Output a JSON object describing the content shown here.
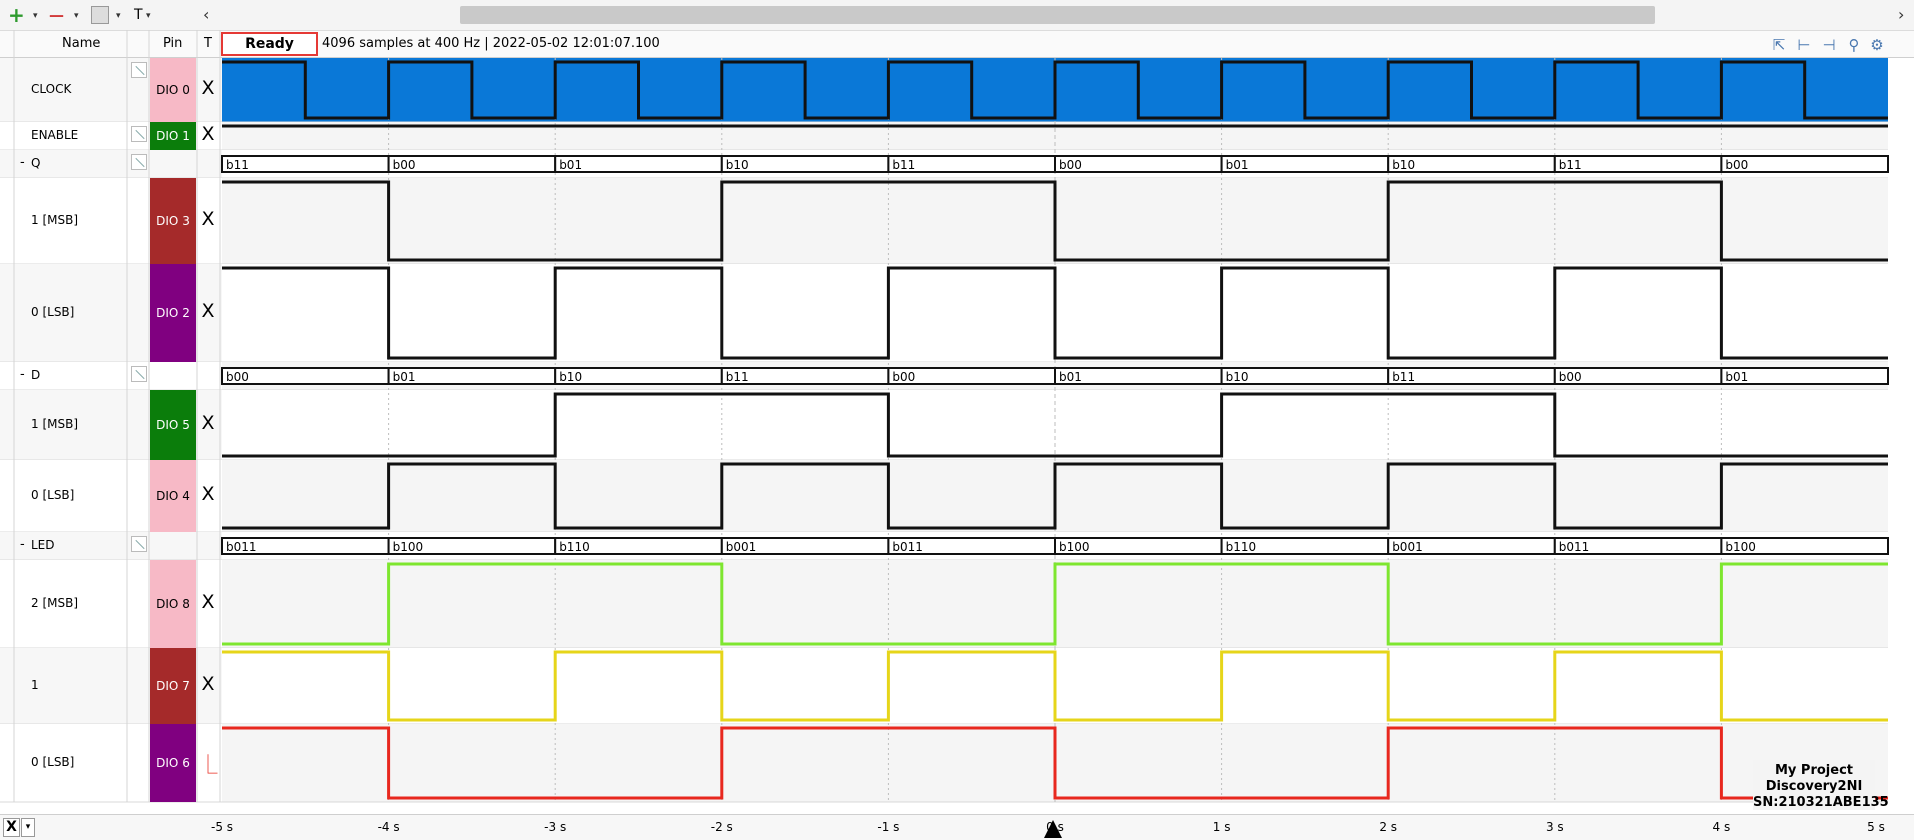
{
  "toolbar": {
    "add_icon": "+",
    "remove_icon": "—",
    "edit_icon": "edit",
    "text_icon": "T",
    "caret": "▾",
    "scroll_left": "‹",
    "scroll_right": "›"
  },
  "header": {
    "col_name": "Name",
    "col_pin": "Pin",
    "col_trigger": "T",
    "status": "Ready",
    "acquisition": "4096 samples at 400 Hz | 2022-05-02 12:01:07.100"
  },
  "colors": {
    "clock_fill": "#0a78d7",
    "row_alt": "#f5f5f5",
    "led_msb": "#7ee62f",
    "led_mid": "#e6d51a",
    "led_lsb": "#e8281e"
  },
  "channels": [
    {
      "name": "CLOCK",
      "pin": "DIO  0",
      "trigger": "X",
      "pin_color": "#f7b9c6",
      "pin_text": "#000"
    },
    {
      "name": "ENABLE",
      "pin": "DIO  1",
      "trigger": "X",
      "pin_color": "#0b7d0b",
      "pin_text": "#fff"
    },
    {
      "name": "Q",
      "toggle": "-",
      "pin": "",
      "trigger": ""
    },
    {
      "name": "1 [MSB]",
      "pin": "DIO  3",
      "trigger": "X",
      "pin_color": "#a52a2a",
      "pin_text": "#fff"
    },
    {
      "name": "0 [LSB]",
      "pin": "DIO  2",
      "trigger": "X",
      "pin_color": "#800080",
      "pin_text": "#fff"
    },
    {
      "name": "D",
      "toggle": "-",
      "pin": "",
      "trigger": ""
    },
    {
      "name": "1 [MSB]",
      "pin": "DIO  5",
      "trigger": "X",
      "pin_color": "#0b7d0b",
      "pin_text": "#fff"
    },
    {
      "name": "0 [LSB]",
      "pin": "DIO  4",
      "trigger": "X",
      "pin_color": "#f7b9c6",
      "pin_text": "#000"
    },
    {
      "name": "LED",
      "toggle": "-",
      "pin": "",
      "trigger": ""
    },
    {
      "name": "2 [MSB]",
      "pin": "DIO  8",
      "trigger": "X",
      "pin_color": "#f7b9c6",
      "pin_text": "#000"
    },
    {
      "name": "1",
      "pin": "DIO  7",
      "trigger": "X",
      "pin_color": "#a52a2a",
      "pin_text": "#fff"
    },
    {
      "name": "0 [LSB]",
      "pin": "DIO  6",
      "trigger": "⎿",
      "pin_color": "#800080",
      "pin_text": "#fff"
    }
  ],
  "bus_values": {
    "Q": [
      "b11",
      "b00",
      "b01",
      "b10",
      "b11",
      "b00",
      "b01",
      "b10",
      "b11",
      "b00"
    ],
    "D": [
      "b00",
      "b01",
      "b10",
      "b11",
      "b00",
      "b01",
      "b10",
      "b11",
      "b00",
      "b01"
    ],
    "LED": [
      "b011",
      "b100",
      "b110",
      "b001",
      "b011",
      "b100",
      "b110",
      "b001",
      "b011",
      "b100"
    ]
  },
  "timeline": {
    "start": -5,
    "end": 5,
    "ticks": [
      "-5 s",
      "-4 s",
      "-3 s",
      "-2 s",
      "-1 s",
      "0 s",
      "1 s",
      "2 s",
      "3 s",
      "4 s",
      "5 s"
    ]
  },
  "footer": {
    "x_button": "X",
    "dropdown": "▾"
  },
  "device": {
    "project": "My Project",
    "model": "Discovery2NI",
    "serial": "SN:210321ABE135"
  }
}
